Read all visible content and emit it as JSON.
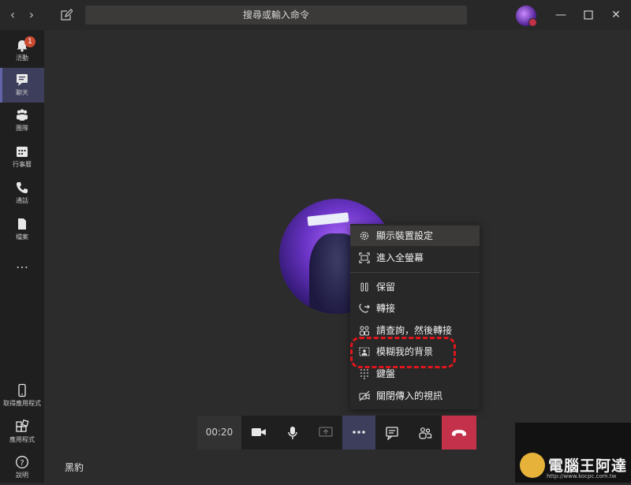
{
  "titlebar": {
    "search_placeholder": "搜尋或輸入命令",
    "back_icon": "chevron-left-icon",
    "forward_icon": "chevron-right-icon",
    "compose_icon": "compose-icon"
  },
  "rail": {
    "items": [
      {
        "label": "活動",
        "icon": "bell-icon",
        "badge": "1"
      },
      {
        "label": "聊天",
        "icon": "chat-icon",
        "active": true
      },
      {
        "label": "團隊",
        "icon": "teams-icon"
      },
      {
        "label": "行事曆",
        "icon": "calendar-icon"
      },
      {
        "label": "通話",
        "icon": "phone-icon"
      },
      {
        "label": "檔案",
        "icon": "file-icon"
      }
    ],
    "more_label": "…",
    "bottom": [
      {
        "label": "取得應用程式",
        "icon": "mobile-icon"
      },
      {
        "label": "應用程式",
        "icon": "apps-icon"
      },
      {
        "label": "說明",
        "icon": "help-icon"
      }
    ]
  },
  "menu": {
    "items": [
      {
        "label": "顯示裝置設定",
        "icon": "gear-icon"
      },
      {
        "label": "進入全螢幕",
        "icon": "fullscreen-icon"
      },
      {
        "label": "保留",
        "icon": "pause-icon"
      },
      {
        "label": "轉接",
        "icon": "transfer-icon"
      },
      {
        "label": "請查詢，然後轉接",
        "icon": "consult-transfer-icon"
      },
      {
        "label": "模糊我的背景",
        "icon": "blur-background-icon"
      },
      {
        "label": "鍵盤",
        "icon": "dialpad-icon"
      },
      {
        "label": "關閉傳入的視訊",
        "icon": "video-off-icon"
      }
    ]
  },
  "callbar": {
    "timer": "00:20",
    "buttons": [
      "camera-icon",
      "microphone-icon",
      "share-screen-icon",
      "more-options-icon",
      "chat-icon",
      "participants-icon",
      "hang-up-icon"
    ]
  },
  "caller_name": "黑豹",
  "watermark": {
    "text": "電腦王阿達",
    "url": "http://www.kocpc.com.tw"
  },
  "colors": {
    "accent": "#6264a7",
    "hangup": "#c4314b",
    "highlight": "#e0151d",
    "badge": "#cc4a31"
  }
}
